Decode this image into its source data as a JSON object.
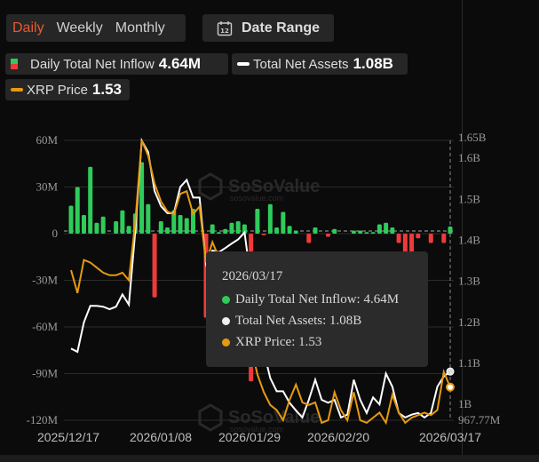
{
  "tabs": [
    {
      "label": "Daily",
      "active": true
    },
    {
      "label": "Weekly",
      "active": false
    },
    {
      "label": "Monthly",
      "active": false
    }
  ],
  "date_range": {
    "label": "Date Range",
    "icon": "calendar-icon",
    "icon_text": "12"
  },
  "legend": [
    {
      "label": "Daily Total Net Inflow",
      "value": "4.64M",
      "color": "#2ecc5a",
      "neg_color": "#f03a3a"
    },
    {
      "label": "Total Net Assets",
      "value": "1.08B",
      "color": "#ffffff"
    },
    {
      "label": "XRP Price",
      "value": "1.53",
      "color": "#e69a10"
    }
  ],
  "tooltip": {
    "date": "2026/03/17",
    "rows": [
      {
        "label": "Daily Total Net Inflow: 4.64M",
        "color": "#2ecc5a"
      },
      {
        "label": "Total Net Assets: 1.08B",
        "color": "#f0f0f0"
      },
      {
        "label": "XRP Price: 1.53",
        "color": "#e69a10"
      }
    ]
  },
  "watermark": {
    "brand": "SoSoValue",
    "url": "sosovalue.com"
  },
  "chart_data": {
    "type": "bar+line",
    "x_ticks": [
      "2025/12/17",
      "2026/01/08",
      "2026/01/29",
      "2026/02/20",
      "2026/03/17"
    ],
    "left_axis": {
      "ticks": [
        "60M",
        "30M",
        "0",
        "-30M",
        "-60M",
        "-90M",
        "-120M"
      ],
      "values": [
        60,
        30,
        0,
        -30,
        -60,
        -90,
        -120
      ],
      "range": [
        -120,
        60
      ],
      "unit": "M"
    },
    "right_axis": {
      "ticks": [
        "1.65B",
        "1.6B",
        "1.5B",
        "1.4B",
        "1.3B",
        "1.2B",
        "1.1B",
        "1B",
        "967.77M"
      ],
      "values": [
        1.65,
        1.6,
        1.5,
        1.4,
        1.3,
        1.2,
        1.1,
        1.0,
        0.96777
      ],
      "range": [
        0.96777,
        1.65
      ],
      "unit": "B"
    },
    "price_range": [
      1.4,
      2.5
    ],
    "series": [
      {
        "name": "Daily Total Net Inflow",
        "unit": "M",
        "values": [
          18,
          30,
          12,
          43,
          7,
          11,
          0,
          8,
          15,
          5,
          13,
          46,
          19,
          -41,
          8,
          4,
          15,
          12,
          10,
          16,
          0,
          -54,
          6,
          1,
          3,
          7,
          8,
          6,
          -95,
          16,
          -1,
          19,
          4,
          14,
          5,
          2,
          0,
          -6,
          4,
          0,
          -2,
          3,
          0,
          0,
          2,
          2,
          1,
          1,
          6,
          7,
          4,
          -6,
          -15,
          -20,
          -3,
          0,
          -6,
          0,
          -6,
          4.64
        ]
      },
      {
        "name": "Total Net Assets",
        "unit": "B",
        "values": [
          1.136,
          1.128,
          1.2,
          1.24,
          1.24,
          1.238,
          1.232,
          1.238,
          1.268,
          1.243,
          1.423,
          1.643,
          1.615,
          1.52,
          1.483,
          1.466,
          1.466,
          1.53,
          1.547,
          1.504,
          1.504,
          1.343,
          1.375,
          1.371,
          1.381,
          1.392,
          1.402,
          1.419,
          1.3,
          1.17,
          1.128,
          1.064,
          1.032,
          1.032,
          1.004,
          0.985,
          0.968,
          1.011,
          1.06,
          1.011,
          1.004,
          1.011,
          0.968,
          0.975,
          1.06,
          1.011,
          0.979,
          1.017,
          1.0,
          1.075,
          1.043,
          0.979,
          0.968,
          0.975,
          0.979,
          0.968,
          0.979,
          1.043,
          1.068,
          1.08
        ]
      },
      {
        "name": "XRP Price",
        "unit": "USD",
        "values": [
          1.99,
          1.9,
          2.03,
          2.02,
          2.0,
          1.98,
          1.97,
          1.97,
          1.98,
          1.95,
          2.18,
          2.5,
          2.44,
          2.33,
          2.26,
          2.22,
          2.21,
          2.29,
          2.3,
          2.21,
          2.24,
          2.02,
          2.1,
          2.04,
          2.0,
          1.97,
          1.9,
          1.79,
          1.69,
          1.58,
          1.51,
          1.46,
          1.44,
          1.4,
          1.48,
          1.54,
          1.47,
          1.46,
          1.47,
          1.39,
          1.4,
          1.51,
          1.44,
          1.4,
          1.51,
          1.4,
          1.39,
          1.41,
          1.43,
          1.39,
          1.5,
          1.43,
          1.39,
          1.41,
          1.42,
          1.43,
          1.42,
          1.44,
          1.59,
          1.53
        ]
      }
    ]
  }
}
